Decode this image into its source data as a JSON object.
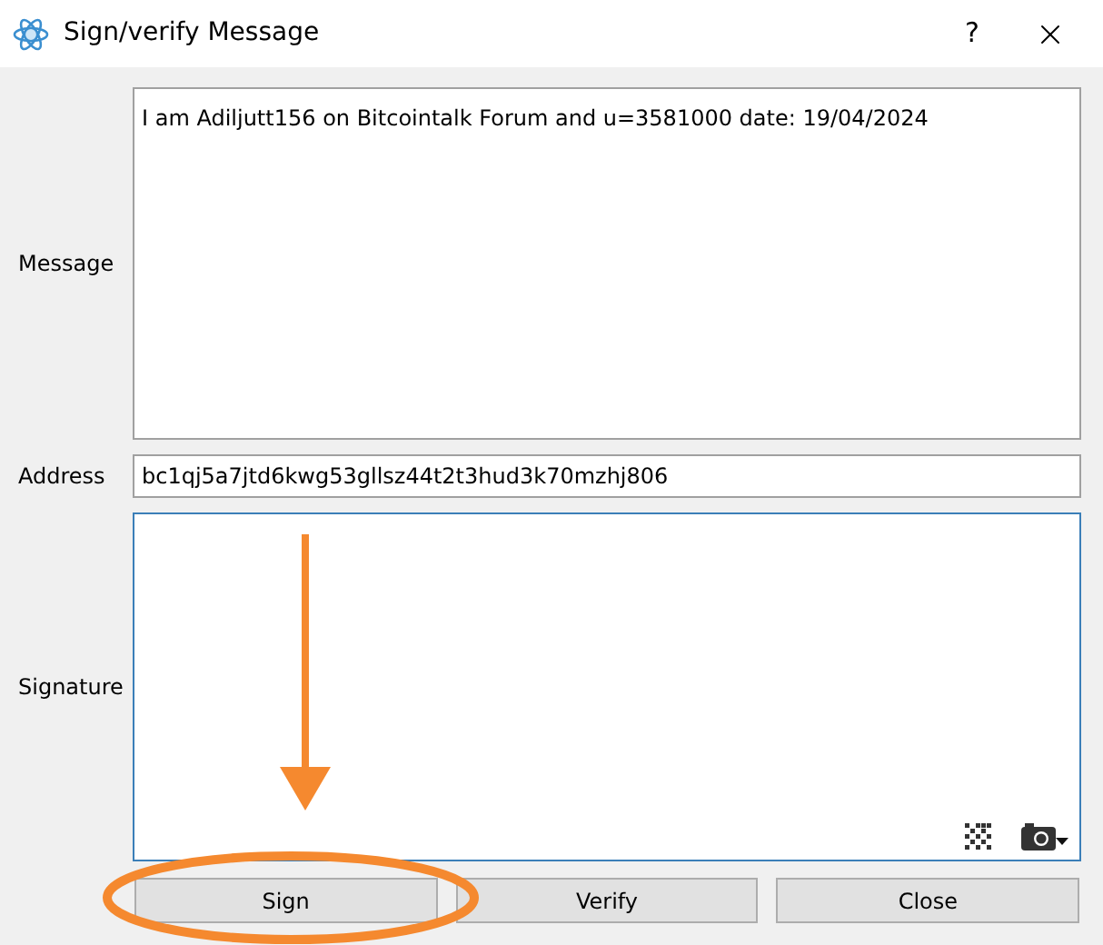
{
  "window": {
    "title": "Sign/verify Message",
    "help": "?"
  },
  "fields": [
    {
      "kind": "multiline",
      "label": "Message",
      "value": "I am Adiljutt156 on Bitcointalk Forum and u=3581000 date: 19/04/2024",
      "focused": false
    },
    {
      "kind": "line",
      "label": "Address",
      "value": "bc1qj5a7jtd6kwg53gllsz44t2t3hud3k70mzhj806",
      "focused": false
    },
    {
      "kind": "signature",
      "label": "Signature",
      "focused": true
    }
  ],
  "buttons": [
    {
      "label": "Sign",
      "highlighted": true
    },
    {
      "label": "Verify",
      "highlighted": false
    },
    {
      "label": "Close",
      "highlighted": false
    }
  ]
}
